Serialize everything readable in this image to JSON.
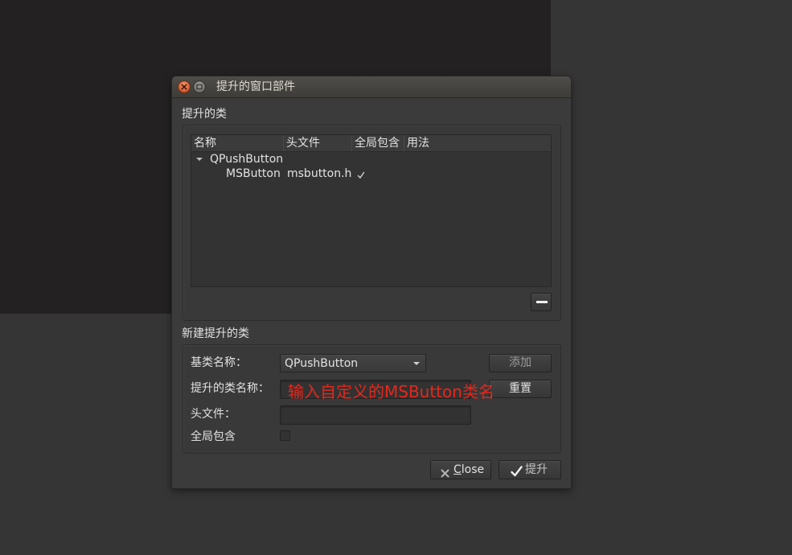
{
  "window": {
    "title": "提升的窗口部件"
  },
  "promoted_classes": {
    "section_label": "提升的类",
    "columns": [
      "名称",
      "头文件",
      "全局包含",
      "用法"
    ],
    "groups": [
      {
        "name": "QPushButton",
        "expanded": true,
        "children": [
          {
            "name": "MSButton",
            "header_file": "msbutton.h",
            "global_include": true,
            "usage": ""
          }
        ]
      }
    ]
  },
  "new_promoted_class": {
    "section_label": "新建提升的类",
    "base_class": {
      "label": "基类名称：",
      "value": "QPushButton"
    },
    "class_name": {
      "label": "提升的类名称：",
      "value": ""
    },
    "header_file": {
      "label": "头文件：",
      "value": ""
    },
    "global_include": {
      "label": "全局包含",
      "checked": false
    },
    "add_button": "添加",
    "reset_button": "重置"
  },
  "annotation": {
    "text": "输入自定义的MSButton类名",
    "color": "#e4281c"
  },
  "footer": {
    "close_button": "Close",
    "promote_button": "提升"
  },
  "icons": {
    "titlebar_close": "close-icon",
    "titlebar_maximize": "maximize-icon",
    "tree_expand": "chevron-down-icon",
    "tree_check": "check-icon",
    "remove": "minus-icon",
    "combo": "dropdown-arrow-icon",
    "footer_close": "close-icon",
    "footer_promote": "check-icon"
  },
  "colors": {
    "titlebar_close": "#e8642f",
    "text": "#e2e2e2",
    "disabled_text": "#9a9a9a",
    "annotation": "#e4281c"
  }
}
